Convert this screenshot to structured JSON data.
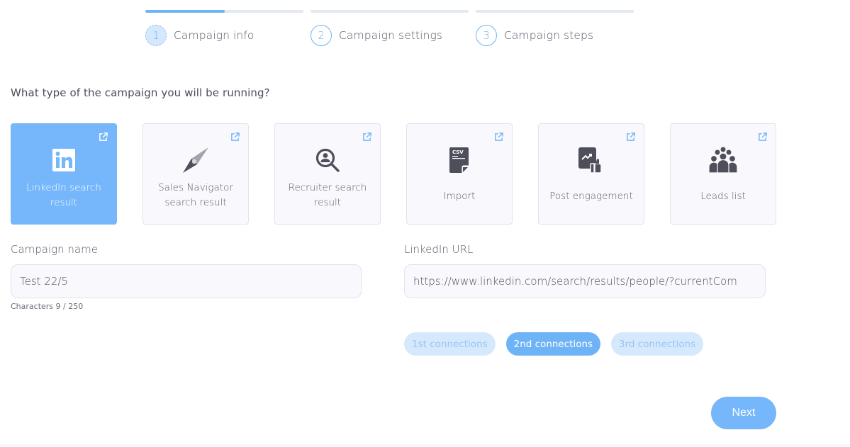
{
  "stepper": {
    "progress": 0.5,
    "steps": [
      {
        "number": "1",
        "label": "Campaign info",
        "active": true
      },
      {
        "number": "2",
        "label": "Campaign settings",
        "active": false
      },
      {
        "number": "3",
        "label": "Campaign steps",
        "active": false
      }
    ]
  },
  "question": "What type of the campaign you will be running?",
  "campaign_types": [
    {
      "label": "LinkedIn search result",
      "icon": "linkedin-icon",
      "selected": true
    },
    {
      "label": "Sales Navigator search result",
      "icon": "compass-icon",
      "selected": false
    },
    {
      "label": "Recruiter search result",
      "icon": "user-search-icon",
      "selected": false
    },
    {
      "label": "Import",
      "icon": "csv-file-icon",
      "selected": false
    },
    {
      "label": "Post engagement",
      "icon": "post-like-icon",
      "selected": false
    },
    {
      "label": "Leads list",
      "icon": "group-icon",
      "selected": false
    }
  ],
  "campaign_name": {
    "label": "Campaign name",
    "value": "Test 22/5",
    "counter": "Characters 9 / 250"
  },
  "linkedin_url": {
    "label": "LinkedIn URL",
    "value": "https://www.linkedin.com/search/results/people/?currentCom"
  },
  "connections": [
    {
      "label": "1st connections",
      "active": false
    },
    {
      "label": "2nd connections",
      "active": true
    },
    {
      "label": "3rd connections",
      "active": false
    }
  ],
  "next_label": "Next",
  "colors": {
    "accent": "#75b7fa",
    "accent_light": "#d6e9fc",
    "icon_dark": "#4f4f5c"
  }
}
